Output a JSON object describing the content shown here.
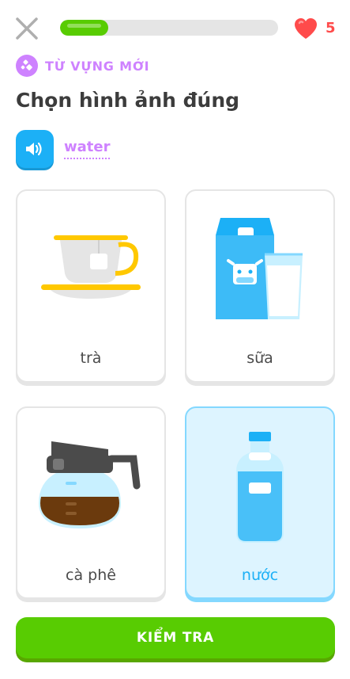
{
  "header": {
    "progress_percent": 22,
    "hearts": "5"
  },
  "lesson": {
    "badge_label": "TỪ VỰNG MỚI",
    "title": "Chọn hình ảnh đúng",
    "word": "water"
  },
  "options": [
    {
      "label": "trà",
      "icon": "tea-cup-icon",
      "selected": false
    },
    {
      "label": "sữa",
      "icon": "milk-carton-icon",
      "selected": false
    },
    {
      "label": "cà phê",
      "icon": "coffee-pot-icon",
      "selected": false
    },
    {
      "label": "nước",
      "icon": "water-bottle-icon",
      "selected": true
    }
  ],
  "footer": {
    "check_label": "KIỂM TRA"
  },
  "colors": {
    "accent_green": "#58cc02",
    "heart_red": "#ff4b4b",
    "purple": "#ce82ff",
    "blue": "#1cb0f6"
  }
}
